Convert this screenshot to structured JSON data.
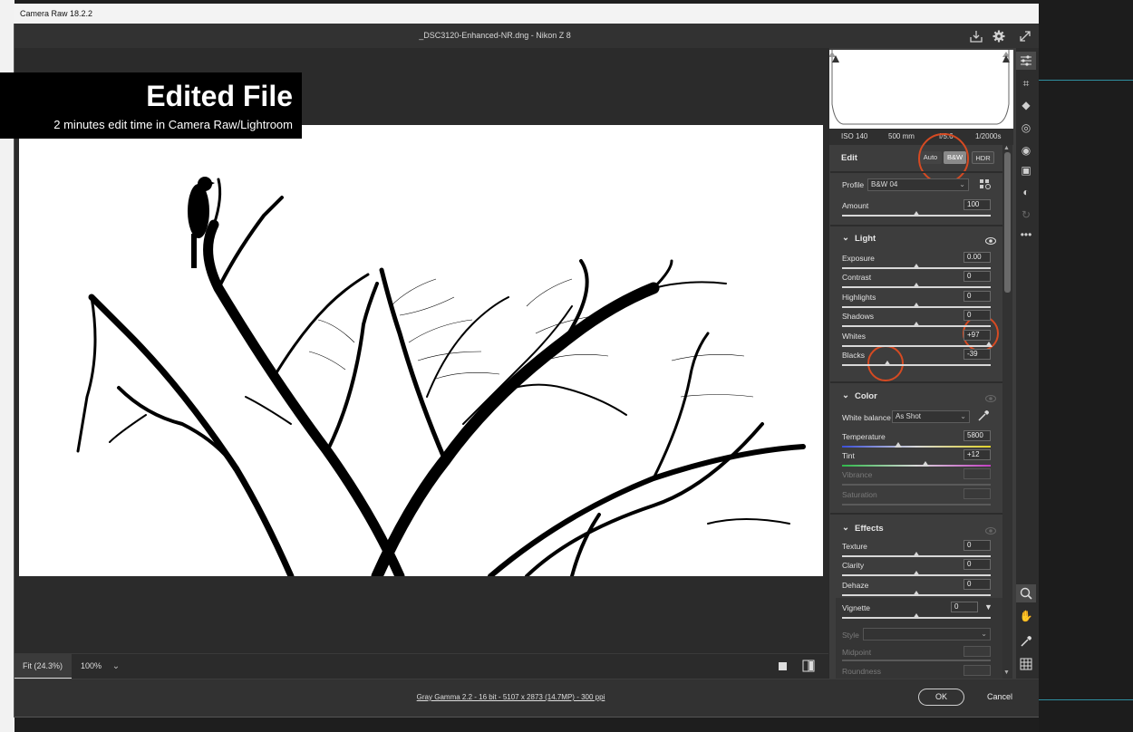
{
  "window": {
    "title": "Camera Raw 18.2.2"
  },
  "document": {
    "title": "_DSC3120-Enhanced-NR.dng  -  Nikon Z 8"
  },
  "top_icons": {
    "save": "save-icon",
    "settings": "gear-icon",
    "fullscreen": "expand-icon"
  },
  "overlay": {
    "title": "Edited File",
    "subtitle": "2 minutes edit time in Camera Raw/Lightroom"
  },
  "zoom": {
    "fit_label": "Fit (24.3%)",
    "percent_label": "100%"
  },
  "status": {
    "info": "Gray Gamma 2.2 - 16 bit - 5107 x 2873 (14.7MP) - 300 ppi"
  },
  "buttons": {
    "ok": "OK",
    "cancel": "Cancel"
  },
  "exif": {
    "iso": "ISO 140",
    "focal": "500 mm",
    "aperture": "f/5.6",
    "shutter": "1/2000s"
  },
  "edit": {
    "header": "Edit",
    "modes": [
      "Auto",
      "B&W",
      "HDR"
    ],
    "selected_mode": "B&W",
    "profile_label": "Profile",
    "profile_value": "B&W 04",
    "amount_label": "Amount",
    "amount_value": "100",
    "amount_level": 0.5
  },
  "light": {
    "header": "Light",
    "sliders": [
      {
        "label": "Exposure",
        "value": "0.00",
        "level": 0.5
      },
      {
        "label": "Contrast",
        "value": "0",
        "level": 0.5
      },
      {
        "label": "Highlights",
        "value": "0",
        "level": 0.5
      },
      {
        "label": "Shadows",
        "value": "0",
        "level": 0.5
      },
      {
        "label": "Whites",
        "value": "+97",
        "level": 0.985
      },
      {
        "label": "Blacks",
        "value": "-39",
        "level": 0.305
      }
    ]
  },
  "color": {
    "header": "Color",
    "white_balance_label": "White balance",
    "white_balance_value": "As Shot",
    "sliders": [
      {
        "label": "Temperature",
        "value": "5800",
        "level": 0.38
      },
      {
        "label": "Tint",
        "value": "+12",
        "level": 0.56
      },
      {
        "label": "Vibrance",
        "value": "",
        "level": 0.5
      },
      {
        "label": "Saturation",
        "value": "",
        "level": 0.5
      }
    ]
  },
  "effects": {
    "header": "Effects",
    "sliders": [
      {
        "label": "Texture",
        "value": "0",
        "level": 0.5
      },
      {
        "label": "Clarity",
        "value": "0",
        "level": 0.5
      },
      {
        "label": "Dehaze",
        "value": "0",
        "level": 0.5
      }
    ],
    "vignette_label": "Vignette",
    "vignette_value": "0",
    "vignette_level": 0.5,
    "style_label": "Style",
    "midpoint_label": "Midpoint",
    "roundness_label": "Roundness"
  },
  "colors": {
    "accent_circle": "#d64a22",
    "panel": "#3d3d3d",
    "canvas": "#2b2b2b"
  }
}
